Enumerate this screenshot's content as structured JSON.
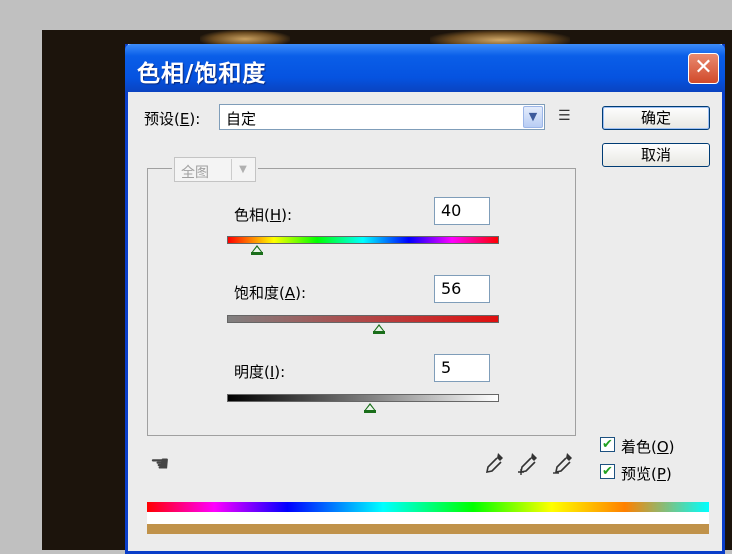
{
  "dialog": {
    "title": "色相/饱和度",
    "close_label": "✕"
  },
  "preset": {
    "label_prefix": "预设(",
    "label_key": "E",
    "label_suffix": "):",
    "value": "自定"
  },
  "buttons": {
    "ok": "确定",
    "cancel": "取消"
  },
  "scope": {
    "value": "全图"
  },
  "hue": {
    "label_prefix": "色相(",
    "label_key": "H",
    "label_suffix": "):",
    "value": "40"
  },
  "saturation": {
    "label_prefix": "饱和度(",
    "label_key": "A",
    "label_suffix": "):",
    "value": "56"
  },
  "lightness": {
    "label_prefix": "明度(",
    "label_key": "I",
    "label_suffix": "):",
    "value": "5"
  },
  "options": {
    "colorize_prefix": "着色(",
    "colorize_key": "O",
    "colorize_suffix": ")",
    "preview_prefix": "预览(",
    "preview_key": "P",
    "preview_suffix": ")"
  },
  "colors": {
    "titlebar": "#0553e0",
    "dialog_border": "#0a3ec9",
    "result_bar": "#c0924a",
    "thumb": "#1a6e1a"
  },
  "icons": {
    "close": "close-icon",
    "dropdown": "chevron-down-icon",
    "menu": "list-menu-icon",
    "hand": "hand-tool-icon",
    "eyedroppers": [
      "eyedropper-icon",
      "eyedropper-plus-icon",
      "eyedropper-minus-icon"
    ]
  }
}
